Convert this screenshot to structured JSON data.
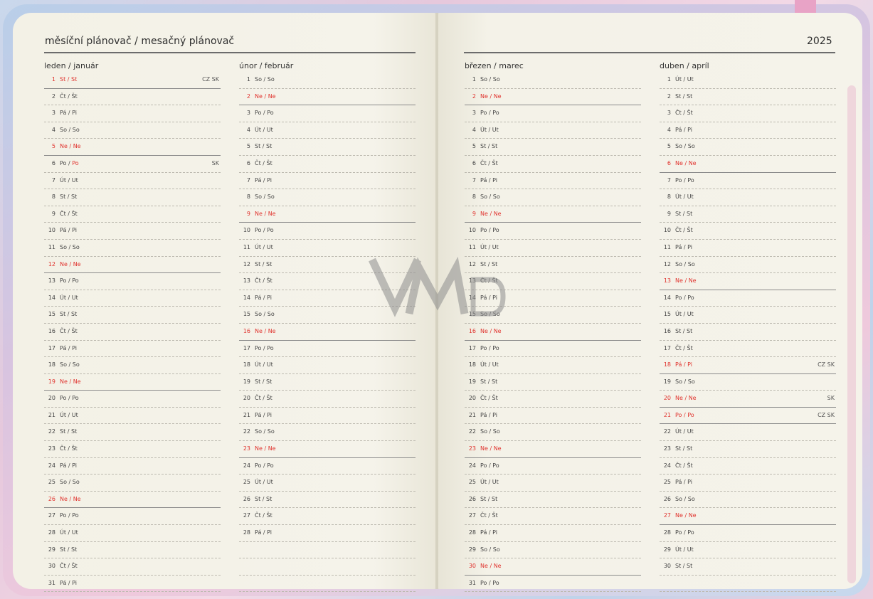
{
  "header": {
    "title": "měsíční plánovač / mesačný plánovač",
    "year": "2025"
  },
  "watermark_text": "VMD",
  "months": [
    {
      "name": "leden / január",
      "days": [
        {
          "n": "1",
          "d": "St / St",
          "red": true,
          "hol": "CZ SK"
        },
        {
          "n": "2",
          "d": "Čt / Št"
        },
        {
          "n": "3",
          "d": "Pá / Pi"
        },
        {
          "n": "4",
          "d": "So / So"
        },
        {
          "n": "5",
          "d": "Ne / Ne",
          "red": true
        },
        {
          "n": "6",
          "d": "Po / ",
          "dr": "Po",
          "hol": "SK"
        },
        {
          "n": "7",
          "d": "Út / Ut"
        },
        {
          "n": "8",
          "d": "St / St"
        },
        {
          "n": "9",
          "d": "Čt / Št"
        },
        {
          "n": "10",
          "d": "Pá / Pi"
        },
        {
          "n": "11",
          "d": "So / So"
        },
        {
          "n": "12",
          "d": "Ne / Ne",
          "red": true
        },
        {
          "n": "13",
          "d": "Po / Po"
        },
        {
          "n": "14",
          "d": "Út / Ut"
        },
        {
          "n": "15",
          "d": "St / St"
        },
        {
          "n": "16",
          "d": "Čt / Št"
        },
        {
          "n": "17",
          "d": "Pá / Pi"
        },
        {
          "n": "18",
          "d": "So / So"
        },
        {
          "n": "19",
          "d": "Ne / Ne",
          "red": true
        },
        {
          "n": "20",
          "d": "Po / Po"
        },
        {
          "n": "21",
          "d": "Út / Ut"
        },
        {
          "n": "22",
          "d": "St / St"
        },
        {
          "n": "23",
          "d": "Čt / Št"
        },
        {
          "n": "24",
          "d": "Pá / Pi"
        },
        {
          "n": "25",
          "d": "So / So"
        },
        {
          "n": "26",
          "d": "Ne / Ne",
          "red": true
        },
        {
          "n": "27",
          "d": "Po / Po"
        },
        {
          "n": "28",
          "d": "Út / Ut"
        },
        {
          "n": "29",
          "d": "St / St"
        },
        {
          "n": "30",
          "d": "Čt / Št"
        },
        {
          "n": "31",
          "d": "Pá / Pi"
        }
      ]
    },
    {
      "name": "únor / február",
      "days": [
        {
          "n": "1",
          "d": "So / So"
        },
        {
          "n": "2",
          "d": "Ne / Ne",
          "red": true
        },
        {
          "n": "3",
          "d": "Po / Po"
        },
        {
          "n": "4",
          "d": "Út / Ut"
        },
        {
          "n": "5",
          "d": "St / St"
        },
        {
          "n": "6",
          "d": "Čt / Št"
        },
        {
          "n": "7",
          "d": "Pá / Pi"
        },
        {
          "n": "8",
          "d": "So / So"
        },
        {
          "n": "9",
          "d": "Ne / Ne",
          "red": true
        },
        {
          "n": "10",
          "d": "Po / Po"
        },
        {
          "n": "11",
          "d": "Út / Ut"
        },
        {
          "n": "12",
          "d": "St / St"
        },
        {
          "n": "13",
          "d": "Čt / Št"
        },
        {
          "n": "14",
          "d": "Pá / Pi"
        },
        {
          "n": "15",
          "d": "So / So"
        },
        {
          "n": "16",
          "d": "Ne / Ne",
          "red": true
        },
        {
          "n": "17",
          "d": "Po / Po"
        },
        {
          "n": "18",
          "d": "Út / Ut"
        },
        {
          "n": "19",
          "d": "St / St"
        },
        {
          "n": "20",
          "d": "Čt / Št"
        },
        {
          "n": "21",
          "d": "Pá / Pi"
        },
        {
          "n": "22",
          "d": "So / So"
        },
        {
          "n": "23",
          "d": "Ne / Ne",
          "red": true
        },
        {
          "n": "24",
          "d": "Po / Po"
        },
        {
          "n": "25",
          "d": "Út / Ut"
        },
        {
          "n": "26",
          "d": "St / St"
        },
        {
          "n": "27",
          "d": "Čt / Št"
        },
        {
          "n": "28",
          "d": "Pá / Pi"
        }
      ]
    },
    {
      "name": "březen / marec",
      "days": [
        {
          "n": "1",
          "d": "So / So"
        },
        {
          "n": "2",
          "d": "Ne / Ne",
          "red": true
        },
        {
          "n": "3",
          "d": "Po / Po"
        },
        {
          "n": "4",
          "d": "Út / Ut"
        },
        {
          "n": "5",
          "d": "St / St"
        },
        {
          "n": "6",
          "d": "Čt / Št"
        },
        {
          "n": "7",
          "d": "Pá / Pi"
        },
        {
          "n": "8",
          "d": "So / So"
        },
        {
          "n": "9",
          "d": "Ne / Ne",
          "red": true
        },
        {
          "n": "10",
          "d": "Po / Po"
        },
        {
          "n": "11",
          "d": "Út / Ut"
        },
        {
          "n": "12",
          "d": "St / St"
        },
        {
          "n": "13",
          "d": "Čt / Št"
        },
        {
          "n": "14",
          "d": "Pá / Pi"
        },
        {
          "n": "15",
          "d": "So / So"
        },
        {
          "n": "16",
          "d": "Ne / Ne",
          "red": true
        },
        {
          "n": "17",
          "d": "Po / Po"
        },
        {
          "n": "18",
          "d": "Út / Ut"
        },
        {
          "n": "19",
          "d": "St / St"
        },
        {
          "n": "20",
          "d": "Čt / Št"
        },
        {
          "n": "21",
          "d": "Pá / Pi"
        },
        {
          "n": "22",
          "d": "So / So"
        },
        {
          "n": "23",
          "d": "Ne / Ne",
          "red": true
        },
        {
          "n": "24",
          "d": "Po / Po"
        },
        {
          "n": "25",
          "d": "Út / Ut"
        },
        {
          "n": "26",
          "d": "St / St"
        },
        {
          "n": "27",
          "d": "Čt / Št"
        },
        {
          "n": "28",
          "d": "Pá / Pi"
        },
        {
          "n": "29",
          "d": "So / So"
        },
        {
          "n": "30",
          "d": "Ne / Ne",
          "red": true
        },
        {
          "n": "31",
          "d": "Po / Po"
        }
      ]
    },
    {
      "name": "duben / apríl",
      "days": [
        {
          "n": "1",
          "d": "Út / Ut"
        },
        {
          "n": "2",
          "d": "St / St"
        },
        {
          "n": "3",
          "d": "Čt / Št"
        },
        {
          "n": "4",
          "d": "Pá / Pi"
        },
        {
          "n": "5",
          "d": "So / So"
        },
        {
          "n": "6",
          "d": "Ne / Ne",
          "red": true
        },
        {
          "n": "7",
          "d": "Po / Po"
        },
        {
          "n": "8",
          "d": "Út / Ut"
        },
        {
          "n": "9",
          "d": "St / St"
        },
        {
          "n": "10",
          "d": "Čt / Št"
        },
        {
          "n": "11",
          "d": "Pá / Pi"
        },
        {
          "n": "12",
          "d": "So / So"
        },
        {
          "n": "13",
          "d": "Ne / Ne",
          "red": true
        },
        {
          "n": "14",
          "d": "Po / Po"
        },
        {
          "n": "15",
          "d": "Út / Ut"
        },
        {
          "n": "16",
          "d": "St / St"
        },
        {
          "n": "17",
          "d": "Čt / Št"
        },
        {
          "n": "18",
          "d": "Pá / Pi",
          "red": true,
          "hol": "CZ SK"
        },
        {
          "n": "19",
          "d": "So / So"
        },
        {
          "n": "20",
          "d": "Ne / Ne",
          "red": true,
          "hol": "SK"
        },
        {
          "n": "21",
          "d": "Po / Po",
          "red": true,
          "hol": "CZ SK"
        },
        {
          "n": "22",
          "d": "Út / Ut"
        },
        {
          "n": "23",
          "d": "St / St"
        },
        {
          "n": "24",
          "d": "Čt / Št"
        },
        {
          "n": "25",
          "d": "Pá / Pi"
        },
        {
          "n": "26",
          "d": "So / So"
        },
        {
          "n": "27",
          "d": "Ne / Ne",
          "red": true
        },
        {
          "n": "28",
          "d": "Po / Po"
        },
        {
          "n": "29",
          "d": "Út / Ut"
        },
        {
          "n": "30",
          "d": "St / St"
        }
      ]
    }
  ],
  "colors": {
    "holiday_red": "#e0322d",
    "paper": "#f4f2e8"
  }
}
